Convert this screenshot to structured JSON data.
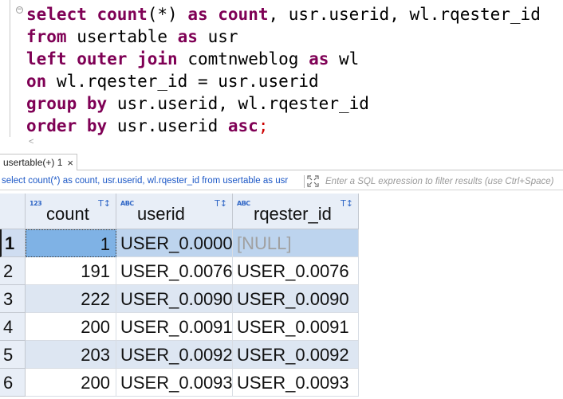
{
  "editor": {
    "fold_marker": "−",
    "lines": [
      [
        {
          "k": "kw",
          "t": "select"
        },
        {
          "k": "tx",
          "t": " "
        },
        {
          "k": "kw",
          "t": "count"
        },
        {
          "k": "tx",
          "t": "(*) "
        },
        {
          "k": "kw",
          "t": "as"
        },
        {
          "k": "tx",
          "t": " "
        },
        {
          "k": "kw",
          "t": "count"
        },
        {
          "k": "tx",
          "t": ", usr.userid, wl.rqester_id"
        }
      ],
      [
        {
          "k": "kw",
          "t": "from"
        },
        {
          "k": "tx",
          "t": " usertable "
        },
        {
          "k": "kw",
          "t": "as"
        },
        {
          "k": "tx",
          "t": " usr"
        }
      ],
      [
        {
          "k": "kw",
          "t": "left"
        },
        {
          "k": "tx",
          "t": " "
        },
        {
          "k": "kw",
          "t": "outer"
        },
        {
          "k": "tx",
          "t": " "
        },
        {
          "k": "kw",
          "t": "join"
        },
        {
          "k": "tx",
          "t": " comtnweblog "
        },
        {
          "k": "kw",
          "t": "as"
        },
        {
          "k": "tx",
          "t": " wl"
        }
      ],
      [
        {
          "k": "kw",
          "t": "on"
        },
        {
          "k": "tx",
          "t": " wl.rqester_id = usr.userid"
        }
      ],
      [
        {
          "k": "kw",
          "t": "group"
        },
        {
          "k": "tx",
          "t": " "
        },
        {
          "k": "kw",
          "t": "by"
        },
        {
          "k": "tx",
          "t": " usr.userid, wl.rqester_id"
        }
      ],
      [
        {
          "k": "kw",
          "t": "order"
        },
        {
          "k": "tx",
          "t": " "
        },
        {
          "k": "kw",
          "t": "by"
        },
        {
          "k": "tx",
          "t": " usr.userid "
        },
        {
          "k": "kw",
          "t": "asc"
        },
        {
          "k": "sc",
          "t": ";"
        }
      ]
    ],
    "scroll_left_glyph": "<"
  },
  "result_tab": {
    "label": "usertable(+) 1",
    "close_glyph": "×"
  },
  "filter": {
    "query_text": "select count(*) as count, usr.userid, wl.rqester_id from usertable as usr",
    "placeholder": "Enter a SQL expression to filter results (use Ctrl+Space)",
    "icon": "expand-arrows-icon"
  },
  "grid": {
    "columns": [
      {
        "name": "count",
        "type_badge": "123",
        "type": "numeric"
      },
      {
        "name": "userid",
        "type_badge": "ABC",
        "type": "text"
      },
      {
        "name": "rqester_id",
        "type_badge": "ABC",
        "type": "text"
      }
    ],
    "sort_filter_glyph": "T↕",
    "rows": [
      {
        "n": "1",
        "count": "1",
        "userid": "USER_0.0000",
        "rqester_id": "[NULL]",
        "selected": true
      },
      {
        "n": "2",
        "count": "191",
        "userid": "USER_0.0076",
        "rqester_id": "USER_0.0076"
      },
      {
        "n": "3",
        "count": "222",
        "userid": "USER_0.0090",
        "rqester_id": "USER_0.0090"
      },
      {
        "n": "4",
        "count": "200",
        "userid": "USER_0.0091",
        "rqester_id": "USER_0.0091"
      },
      {
        "n": "5",
        "count": "203",
        "userid": "USER_0.0092",
        "rqester_id": "USER_0.0092"
      },
      {
        "n": "6",
        "count": "200",
        "userid": "USER_0.0093",
        "rqester_id": "USER_0.0093"
      }
    ]
  },
  "colors": {
    "keyword": "#7f0055",
    "semicolon": "#cc0000",
    "filter_query": "#1b57c6",
    "selected_cell": "#7fb2e5",
    "alt_row": "#dde6f2",
    "header": "#e8eef7"
  }
}
